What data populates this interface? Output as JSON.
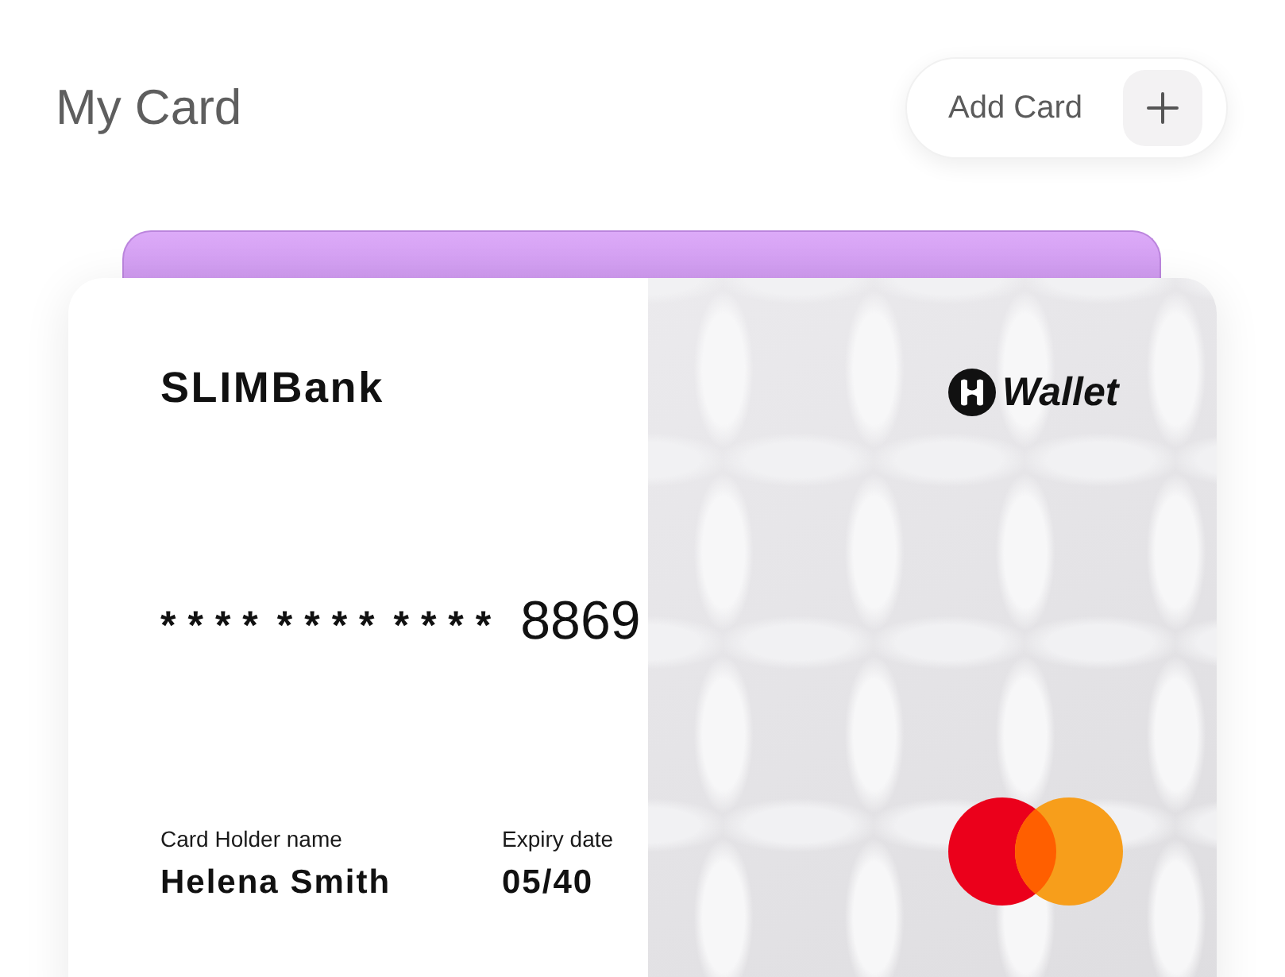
{
  "header": {
    "title": "My Card",
    "add_button": {
      "label": "Add Card"
    }
  },
  "card_stack": [
    {
      "kind": "back"
    },
    {
      "kind": "front",
      "bank": "SLIMBank",
      "brand": "Wallet",
      "number_masked": "**** **** ****",
      "number_last": "8869",
      "holder_label": "Card Holder name",
      "holder": "Helena Smith",
      "expiry_label": "Expiry date",
      "expiry": "05/40"
    }
  ]
}
